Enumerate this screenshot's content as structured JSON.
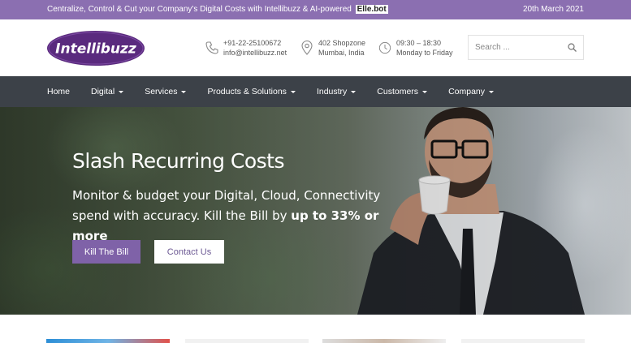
{
  "topbar": {
    "message": "Centralize, Control & Cut your Company's Digital Costs with Intellibuzz & AI-powered",
    "brand": "Elle.bot",
    "date": "20th March 2021"
  },
  "header": {
    "logo_text": "Intellibuzz",
    "phone": "+91-22-25100672",
    "email": "info@intellibuzz.net",
    "address_line1": "402 Shopzone",
    "address_line2": "Mumbai, India",
    "hours": "09:30 – 18:30",
    "days": "Monday to Friday",
    "search_placeholder": "Search ..."
  },
  "nav": {
    "items": [
      {
        "label": "Home",
        "has_menu": false
      },
      {
        "label": "Digital",
        "has_menu": true
      },
      {
        "label": "Services",
        "has_menu": true
      },
      {
        "label": "Products & Solutions",
        "has_menu": true
      },
      {
        "label": "Industry",
        "has_menu": true
      },
      {
        "label": "Customers",
        "has_menu": true
      },
      {
        "label": "Company",
        "has_menu": true
      }
    ]
  },
  "hero": {
    "title": "Slash Recurring Costs",
    "subtitle_lead": "Monitor & budget your Digital, Cloud, Connectivity spend with accuracy. Kill the Bill by",
    "subtitle_bold": "up to 33% or more",
    "primary_button": "Kill The Bill",
    "secondary_button": "Contact Us"
  },
  "colors": {
    "accent": "#7f62a8",
    "topbar": "#8b6fb1",
    "nav": "#3c4148"
  }
}
